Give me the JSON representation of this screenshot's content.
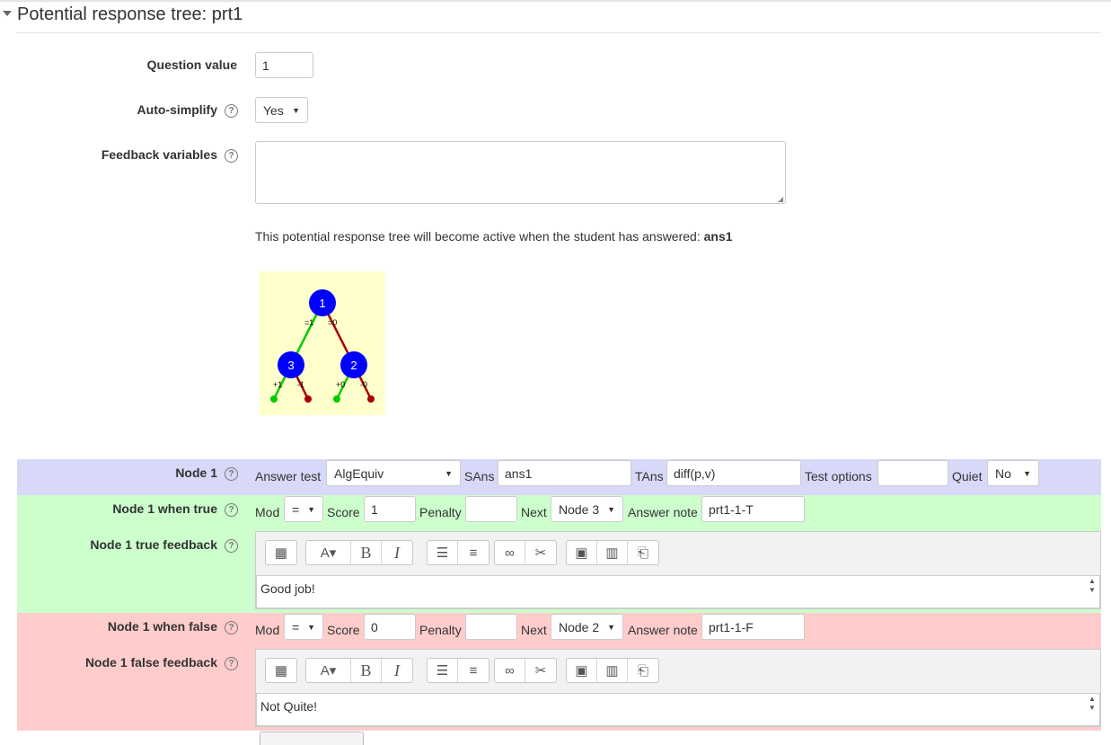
{
  "section": {
    "title": "Potential response tree: prt1"
  },
  "question_value": {
    "label": "Question value",
    "value": "1"
  },
  "auto_simplify": {
    "label": "Auto-simplify",
    "value": "Yes"
  },
  "feedback_variables": {
    "label": "Feedback variables",
    "value": ""
  },
  "active_note": {
    "text": "This potential response tree will become active when the student has answered: ",
    "answer": "ans1"
  },
  "tree": {
    "nodes": [
      "1",
      "3",
      "2"
    ],
    "edge_labels": {
      "n1_true": "=1",
      "n1_false": "=0",
      "n3_true": "+1",
      "n3_false": "-1",
      "n2_true": "+0",
      "n2_false": "-0"
    },
    "colors": {
      "true": "#00cc00",
      "false": "#aa0000",
      "node": "#0000ff",
      "background": "#ffffcc"
    }
  },
  "node1": {
    "label": "Node 1",
    "answer_test_label": "Answer test",
    "answer_test": "AlgEquiv",
    "sans_label": "SAns",
    "sans": "ans1",
    "tans_label": "TAns",
    "tans": "diff(p,v)",
    "test_options_label": "Test options",
    "test_options": "",
    "quiet_label": "Quiet",
    "quiet": "No"
  },
  "true_branch": {
    "label": "Node 1 when true",
    "mod_label": "Mod",
    "mod": "=",
    "score_label": "Score",
    "score": "1",
    "penalty_label": "Penalty",
    "penalty": "",
    "next_label": "Next",
    "next": "Node 3",
    "note_label": "Answer note",
    "note": "prt1-1-T",
    "feedback_label": "Node 1 true feedback",
    "feedback": "Good job!"
  },
  "false_branch": {
    "label": "Node 1 when false",
    "mod_label": "Mod",
    "mod": "=",
    "score_label": "Score",
    "score": "0",
    "penalty_label": "Penalty",
    "penalty": "",
    "next_label": "Next",
    "next": "Node 2",
    "note_label": "Answer note",
    "note": "prt1-1-F",
    "feedback_label": "Node 1 false feedback",
    "feedback": "Not Quite!"
  },
  "colors": {
    "node_band": "#d8d8f8",
    "true_band": "#ccffcc",
    "false_band": "#ffcccc"
  },
  "toolbar_icons": [
    "toolbar-toggle-icon",
    "font-color-icon",
    "bold-icon",
    "italic-icon",
    "bullet-list-icon",
    "numbered-list-icon",
    "link-icon",
    "unlink-icon",
    "image-icon",
    "media-icon",
    "manage-files-icon"
  ],
  "toolbar_glyphs": {
    "bold": "B",
    "italic": "I"
  }
}
